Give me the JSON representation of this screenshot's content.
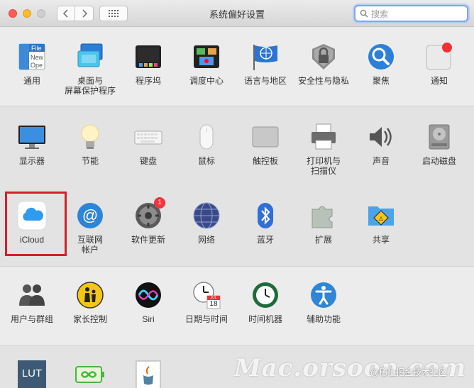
{
  "window": {
    "title": "系统偏好设置"
  },
  "search": {
    "placeholder": "搜索"
  },
  "rows": [
    {
      "items": [
        {
          "id": "general",
          "label": [
            "通用"
          ],
          "icon": "general-icon"
        },
        {
          "id": "desktop",
          "label": [
            "桌面与",
            "屏幕保护程序"
          ],
          "icon": "desktop-icon"
        },
        {
          "id": "dock",
          "label": [
            "程序坞"
          ],
          "icon": "dock-icon"
        },
        {
          "id": "mission",
          "label": [
            "调度中心"
          ],
          "icon": "mission-control-icon"
        },
        {
          "id": "language",
          "label": [
            "语言与地区"
          ],
          "icon": "language-icon"
        },
        {
          "id": "security",
          "label": [
            "安全性与隐私"
          ],
          "icon": "security-icon"
        },
        {
          "id": "spotlight",
          "label": [
            "聚焦"
          ],
          "icon": "spotlight-icon"
        },
        {
          "id": "notifications",
          "label": [
            "通知"
          ],
          "icon": "notifications-icon"
        }
      ]
    },
    {
      "items": [
        {
          "id": "displays",
          "label": [
            "显示器"
          ],
          "icon": "display-icon"
        },
        {
          "id": "energy",
          "label": [
            "节能"
          ],
          "icon": "energy-saver-icon"
        },
        {
          "id": "keyboard",
          "label": [
            "键盘"
          ],
          "icon": "keyboard-icon"
        },
        {
          "id": "mouse",
          "label": [
            "鼠标"
          ],
          "icon": "mouse-icon"
        },
        {
          "id": "trackpad",
          "label": [
            "触控板"
          ],
          "icon": "trackpad-icon"
        },
        {
          "id": "printers",
          "label": [
            "打印机与",
            "扫描仪"
          ],
          "icon": "printer-icon"
        },
        {
          "id": "sound",
          "label": [
            "声音"
          ],
          "icon": "sound-icon"
        },
        {
          "id": "startup",
          "label": [
            "启动磁盘"
          ],
          "icon": "startup-disk-icon"
        }
      ]
    },
    {
      "items": [
        {
          "id": "icloud",
          "label": [
            "iCloud"
          ],
          "icon": "icloud-icon"
        },
        {
          "id": "internet",
          "label": [
            "互联网",
            "帐户"
          ],
          "icon": "internet-accounts-icon"
        },
        {
          "id": "update",
          "label": [
            "软件更新"
          ],
          "icon": "software-update-icon",
          "badge": "1"
        },
        {
          "id": "network",
          "label": [
            "网络"
          ],
          "icon": "network-icon"
        },
        {
          "id": "bluetooth",
          "label": [
            "蓝牙"
          ],
          "icon": "bluetooth-icon"
        },
        {
          "id": "extensions",
          "label": [
            "扩展"
          ],
          "icon": "extensions-icon"
        },
        {
          "id": "sharing",
          "label": [
            "共享"
          ],
          "icon": "sharing-icon"
        }
      ]
    },
    {
      "items": [
        {
          "id": "users",
          "label": [
            "用户与群组"
          ],
          "icon": "users-icon"
        },
        {
          "id": "parental",
          "label": [
            "家长控制"
          ],
          "icon": "parental-controls-icon"
        },
        {
          "id": "siri",
          "label": [
            "Siri"
          ],
          "icon": "siri-icon"
        },
        {
          "id": "datetime",
          "label": [
            "日期与时间"
          ],
          "icon": "date-time-icon",
          "calendar_day": "18",
          "calendar_month": "JUL"
        },
        {
          "id": "timemachine",
          "label": [
            "时间机器"
          ],
          "icon": "time-machine-icon"
        },
        {
          "id": "accessibility",
          "label": [
            "辅助功能"
          ],
          "icon": "accessibility-icon"
        }
      ]
    },
    {
      "items": [
        {
          "id": "lut",
          "label": [],
          "icon": "lut-icon",
          "icon_text": "LUT"
        },
        {
          "id": "battery",
          "label": [],
          "icon": "battery-icon"
        },
        {
          "id": "java",
          "label": [],
          "icon": "java-icon"
        }
      ]
    }
  ],
  "general_icon_text": [
    "File",
    "New",
    "Ope"
  ],
  "watermark": "Mac.orsoon.com",
  "credit": "@稀土掘金技术社区"
}
